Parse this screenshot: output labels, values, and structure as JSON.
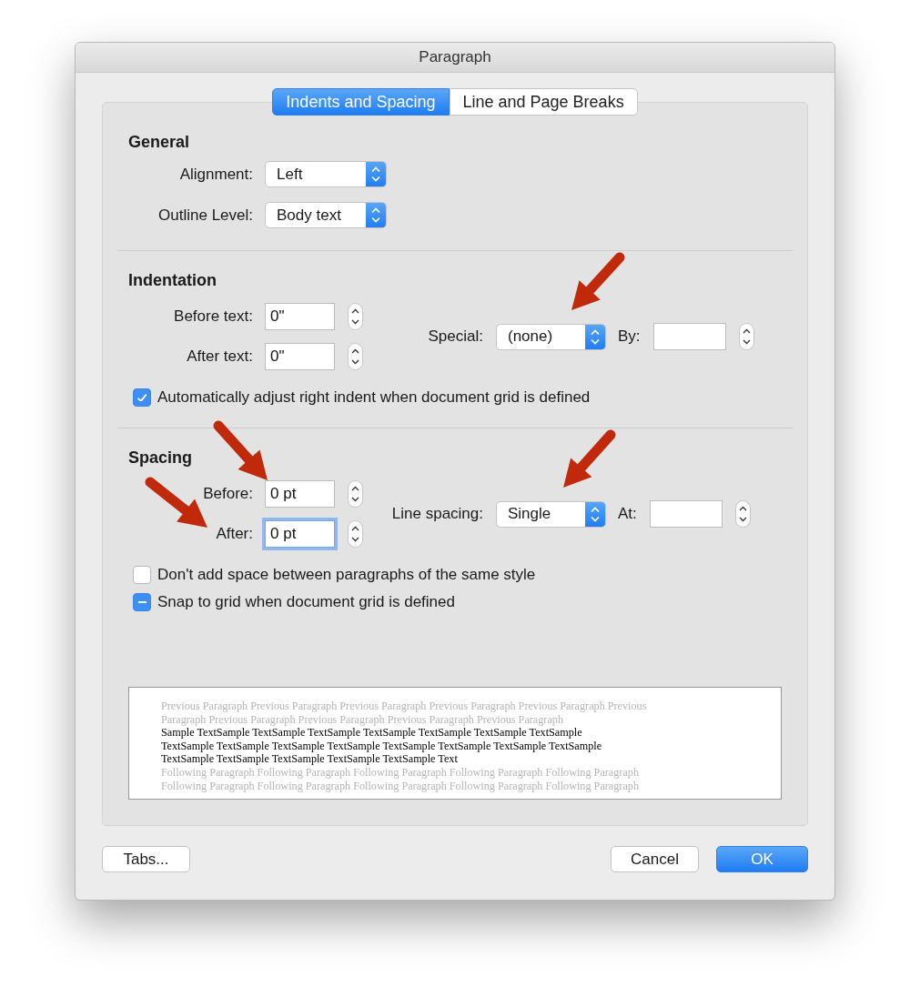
{
  "window": {
    "title": "Paragraph"
  },
  "tabs": [
    {
      "label": "Indents and Spacing",
      "selected": true
    },
    {
      "label": "Line and Page Breaks",
      "selected": false
    }
  ],
  "general": {
    "heading": "General",
    "popups": [
      {
        "label": "Alignment:",
        "value": "Left"
      },
      {
        "label": "Outline Level:",
        "value": "Body text"
      }
    ]
  },
  "indentation": {
    "heading": "Indentation",
    "fields": [
      {
        "label": "Before text:",
        "value": "0\"",
        "focused": false
      },
      {
        "label": "After text:",
        "value": "0\"",
        "focused": false
      }
    ],
    "special": {
      "label": "Special:",
      "value": "(none)"
    },
    "by": {
      "label": "By:"
    },
    "checkboxes": [
      {
        "label": "Automatically adjust right indent when document grid is defined",
        "checked": true
      }
    ]
  },
  "spacing": {
    "heading": "Spacing",
    "fields": [
      {
        "label": "Before:",
        "value": "0 pt",
        "focused": false
      },
      {
        "label": "After:",
        "value": "0 pt",
        "focused": true
      }
    ],
    "special": {
      "label": "Line spacing:",
      "value": "Single"
    },
    "by": {
      "label": "At:"
    },
    "checkboxes": [
      {
        "label": "Don't add space between paragraphs of the same style",
        "checked": false
      },
      {
        "label": "Snap to grid when document grid is defined",
        "checked": true,
        "mixed": true
      }
    ]
  },
  "preview": {
    "lines": [
      {
        "kind": "other",
        "text": "Previous Paragraph Previous Paragraph Previous Paragraph Previous Paragraph Previous Paragraph Previous"
      },
      {
        "kind": "other",
        "text": "Paragraph Previous Paragraph Previous Paragraph Previous Paragraph Previous Paragraph"
      },
      {
        "kind": "sample",
        "text": "Sample TextSample TextSample TextSample TextSample TextSample TextSample TextSample"
      },
      {
        "kind": "sample",
        "text": "TextSample TextSample TextSample TextSample TextSample TextSample TextSample TextSample"
      },
      {
        "kind": "sample",
        "text": "TextSample TextSample TextSample TextSample TextSample Text"
      },
      {
        "kind": "other",
        "text": "Following Paragraph Following Paragraph Following Paragraph Following Paragraph Following Paragraph"
      },
      {
        "kind": "other",
        "text": "Following Paragraph Following Paragraph Following Paragraph Following Paragraph Following Paragraph"
      }
    ]
  },
  "buttons": [
    {
      "label": "Tabs...",
      "kind": "normal"
    },
    {
      "label": "Cancel",
      "kind": "normal"
    },
    {
      "label": "OK",
      "kind": "default"
    }
  ]
}
